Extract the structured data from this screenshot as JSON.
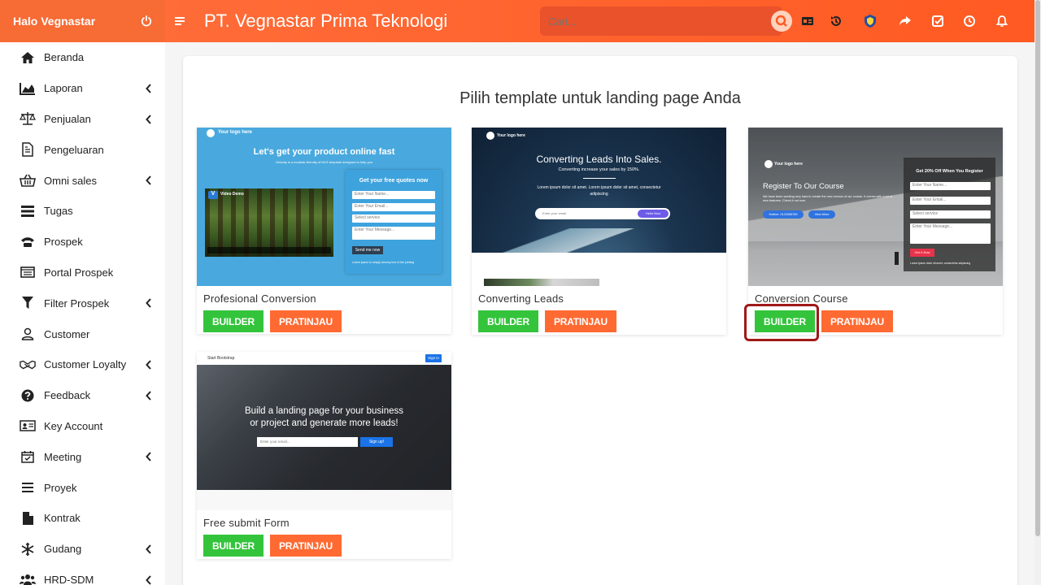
{
  "header": {
    "greeting": "Halo Vegnastar",
    "company": "PT. Vegnastar Prima Teknologi",
    "search_placeholder": "Cari..."
  },
  "sidebar": {
    "items": [
      {
        "label": "Beranda",
        "icon": "home-icon",
        "chevron": false
      },
      {
        "label": "Laporan",
        "icon": "area-chart-icon",
        "chevron": true
      },
      {
        "label": "Penjualan",
        "icon": "balance-scale-icon",
        "chevron": true
      },
      {
        "label": "Pengeluaran",
        "icon": "document-icon",
        "chevron": false
      },
      {
        "label": "Omni sales",
        "icon": "basket-icon",
        "chevron": true
      },
      {
        "label": "Tugas",
        "icon": "tasks-icon",
        "chevron": false
      },
      {
        "label": "Prospek",
        "icon": "phone-icon",
        "chevron": false
      },
      {
        "label": "Portal Prospek",
        "icon": "portal-icon",
        "chevron": false
      },
      {
        "label": "Filter Prospek",
        "icon": "filter-icon",
        "chevron": true
      },
      {
        "label": "Customer",
        "icon": "user-icon",
        "chevron": false
      },
      {
        "label": "Customer Loyalty",
        "icon": "handshake-icon",
        "chevron": true
      },
      {
        "label": "Feedback",
        "icon": "question-icon",
        "chevron": true
      },
      {
        "label": "Key Account",
        "icon": "id-card-icon",
        "chevron": false
      },
      {
        "label": "Meeting",
        "icon": "calendar-check-icon",
        "chevron": true
      },
      {
        "label": "Proyek",
        "icon": "bars-icon",
        "chevron": false
      },
      {
        "label": "Kontrak",
        "icon": "file-icon",
        "chevron": false
      },
      {
        "label": "Gudang",
        "icon": "snowflake-icon",
        "chevron": true
      },
      {
        "label": "HRD-SDM",
        "icon": "users-icon",
        "chevron": true
      }
    ]
  },
  "main": {
    "title": "Pilih template untuk landing page Anda",
    "builder_label": "BUILDER",
    "preview_label": "PRATINJAU",
    "templates": [
      {
        "name": "Profesional Conversion",
        "thumb": {
          "logo": "Your logo here",
          "headline": "Let's get your product online fast",
          "sub": "Velocity is a modular-friendly of MLS template designed to help you",
          "video_title": "Video Demo",
          "form_title": "Get your free quotes now",
          "fields": [
            "Enter Your Name...",
            "Enter Your Email...",
            "Select service",
            "Enter Your Message..."
          ],
          "submit": "Send me now",
          "note": "Lorem ipsum to simply dummy text of the printing"
        }
      },
      {
        "name": "Converting Leads",
        "thumb": {
          "logo": "Your logo here",
          "headline": "Converting Leads Into Sales.",
          "sub": "Converting increase your sales by 150%.",
          "body": "Lorem ipsum dolor sit amet. Lorem ipsum dolor sit amet, consectetur adipiscing",
          "email": "Enter your email",
          "cta": "Hello Now"
        }
      },
      {
        "name": "Conversion Course",
        "thumb": {
          "logo": "Your logo here",
          "headline": "Register To Our Course",
          "sub": "We have been working very hard to create the new version of our course. It comes with a lot of new features. Check it out now.",
          "btn1": "Hotline: 0123456789",
          "btn2": "View More",
          "form_title": "Get 20% Off When You Register",
          "fields": [
            "Enter Your Name...",
            "Enter Your Email...",
            "Select service",
            "Enter Your Message..."
          ],
          "submit": "Get It Now",
          "note": "Lorem ipsum dolor sit amet, consectetur adipiscing"
        }
      },
      {
        "name": "Free submit Form",
        "thumb": {
          "brand": "Start Bootstrap",
          "signin": "Sign in",
          "headline1": "Build a landing page for your business",
          "headline2": "or project and generate more leads!",
          "email": "Enter your email...",
          "cta": "Sign up!"
        }
      }
    ]
  },
  "colors": {
    "header": "#ff6a32",
    "builder": "#34c43c",
    "preview": "#ff6a32",
    "highlight": "#a01818"
  }
}
